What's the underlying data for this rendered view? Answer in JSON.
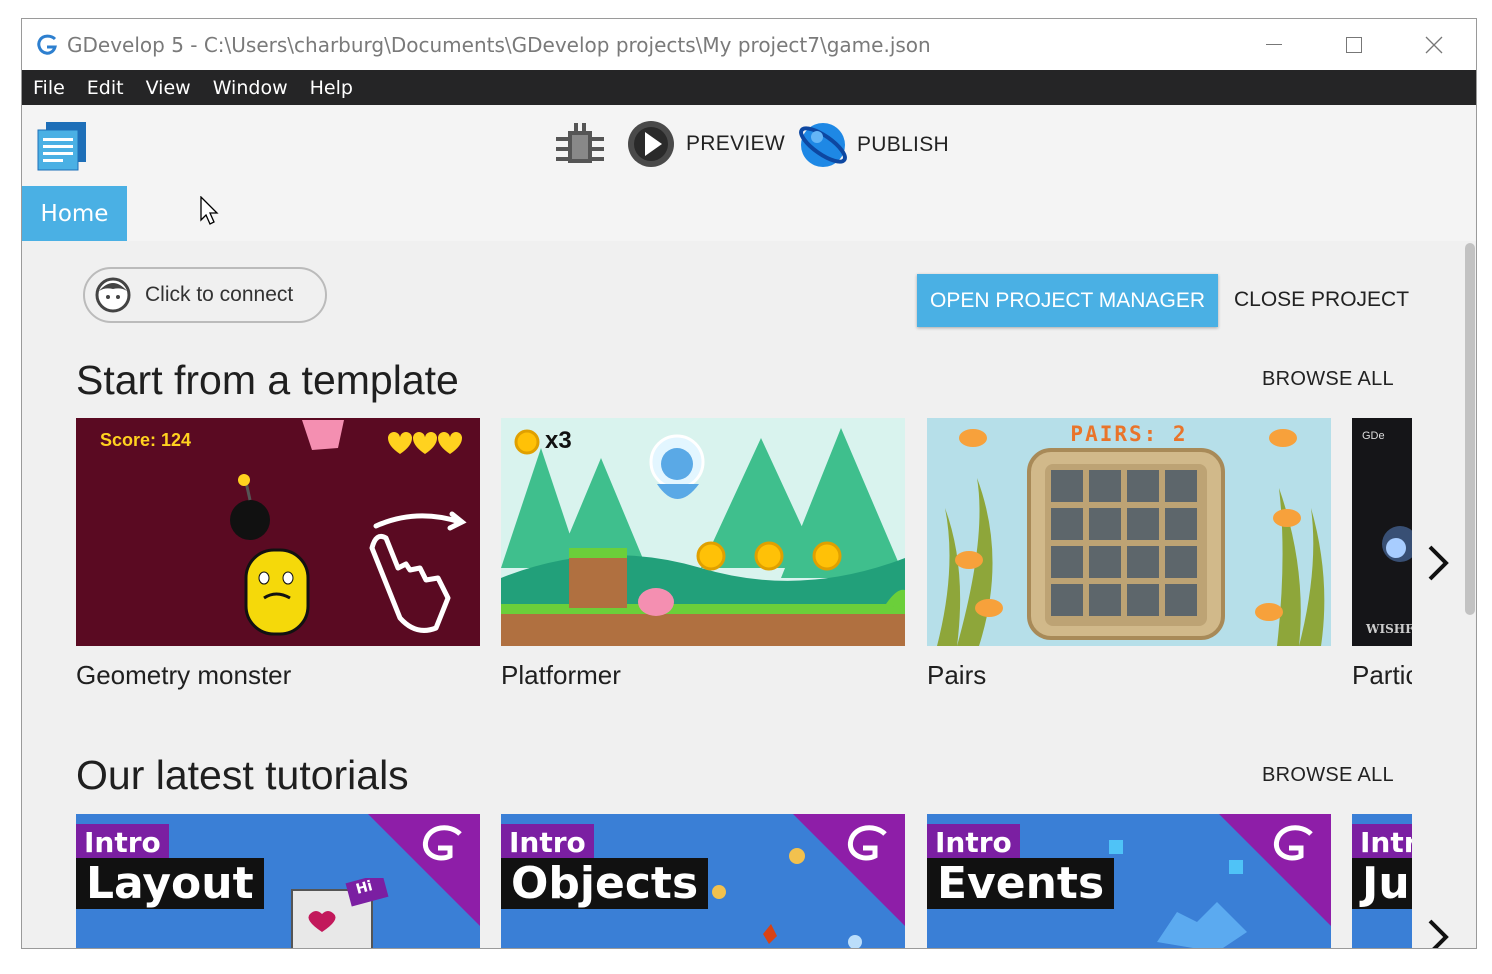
{
  "window": {
    "title": "GDevelop 5 - C:\\Users\\charburg\\Documents\\GDevelop projects\\My project7\\game.json"
  },
  "menubar": {
    "items": [
      "File",
      "Edit",
      "View",
      "Window",
      "Help"
    ]
  },
  "toolbar": {
    "preview_label": "PREVIEW",
    "publish_label": "PUBLISH"
  },
  "tabs": {
    "home_label": "Home"
  },
  "home": {
    "connect_label": "Click to connect",
    "open_project_manager_label": "OPEN PROJECT MANAGER",
    "close_project_label": "CLOSE PROJECT",
    "templates": {
      "title": "Start from a template",
      "browse_all": "BROWSE ALL",
      "items": [
        {
          "name": "Geometry monster",
          "score_text": "Score: 124"
        },
        {
          "name": "Platformer",
          "coin_text": "x3"
        },
        {
          "name": "Pairs",
          "pairs_text": "PAIRS: 2"
        },
        {
          "name": "Partic",
          "logo_text": "GDe",
          "watermark": "WISHF"
        }
      ]
    },
    "tutorials": {
      "title": "Our latest tutorials",
      "browse_all": "BROWSE ALL",
      "items": [
        {
          "tag": "Intro",
          "name": "Layout",
          "badge": "Hi"
        },
        {
          "tag": "Intro",
          "name": "Objects"
        },
        {
          "tag": "Intro",
          "name": "Events"
        },
        {
          "tag": "Intro",
          "name": "Ju"
        }
      ]
    }
  },
  "colors": {
    "accent": "#4ab0e4",
    "menubar_bg": "#252526",
    "geometry_bg": "#5a0a22",
    "tutorial_purple": "#7b1fa2"
  }
}
